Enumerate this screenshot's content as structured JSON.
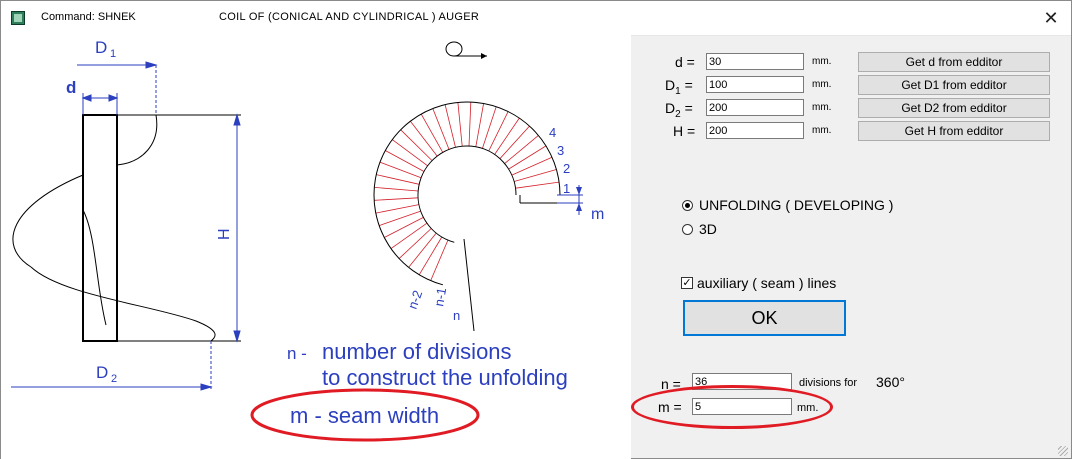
{
  "titlebar": {
    "command": "Command: SHNEK",
    "title": "COIL  OF  (CONICAL  AND  CYLINDRICAL )  AUGER",
    "close": "✕"
  },
  "diagram": {
    "label_D1": "D",
    "label_D1_sub": "1",
    "label_d": "d",
    "label_H": "H",
    "label_D2": "D",
    "label_D2_sub": "2",
    "label_m": "m",
    "seg_1": "1",
    "seg_2": "2",
    "seg_3": "3",
    "seg_4": "4",
    "seg_n": "n",
    "seg_n1": "n-1",
    "seg_n2": "n-2",
    "n_prefix": "n -",
    "n_line1": "number of divisions",
    "n_line2": "to construct the unfolding",
    "m_text": "m - seam width"
  },
  "params": {
    "d_label": "d =",
    "d_value": "30",
    "D1_label": "D",
    "D1_sub": "1",
    "D1_eq": "=",
    "D1_value": "100",
    "D2_label": "D",
    "D2_sub": "2",
    "D2_eq": "=",
    "D2_value": "200",
    "H_label": "H =",
    "H_value": "200",
    "unit": "mm.",
    "get_d": "Get  d  from edditor",
    "get_D1": "Get  D1  from edditor",
    "get_D2": "Get  D2  from edditor",
    "get_H": "Get  H  from edditor"
  },
  "mode": {
    "unfolding": "UNFOLDING ( DEVELOPING )",
    "threed": "3D",
    "selected": "UNFOLDING ( DEVELOPING )"
  },
  "aux": {
    "label": "auxiliary  ( seam ) lines",
    "checked": true
  },
  "ok": "OK",
  "divisions": {
    "n_label": "n =",
    "n_value": "36",
    "n_suffix": "divisions for",
    "n_degrees": "360°",
    "m_label": "m =",
    "m_value": "5",
    "m_unit": "mm."
  },
  "colors": {
    "diagram_blue": "#2b3fbf",
    "annotation_red": "#e01b24",
    "ok_border": "#0078d7"
  }
}
